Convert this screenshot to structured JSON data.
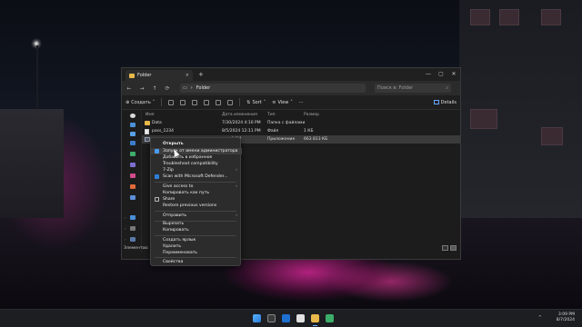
{
  "window": {
    "tab_title": "Folder",
    "tab_close": "×",
    "tab_add": "+",
    "controls": [
      "—",
      "▢",
      "✕"
    ]
  },
  "addressbar": {
    "back": "←",
    "forward": "→",
    "up": "↑",
    "refresh": "⟳",
    "path_separator": "›",
    "path": "Folder",
    "search_placeholder": "Поиск в: Folder"
  },
  "toolbar": {
    "create_label": "Создать",
    "sort_label": "Sort",
    "view_label": "View",
    "more_label": "···",
    "details_label": "Details"
  },
  "columns": {
    "name": "Имя",
    "date": "Дата изменения",
    "type": "Тип",
    "size": "Размер"
  },
  "rows": [
    {
      "name": "Data",
      "date": "7/30/2024 4:10 PM",
      "type": "Папка с файлами",
      "size": ""
    },
    {
      "name": "pass_1234",
      "date": "8/5/2024 12:11 PM",
      "type": "Файл",
      "size": "1 КБ"
    },
    {
      "name": "",
      "date": "...8 PM",
      "type": "Приложение",
      "size": "663 813 КБ"
    }
  ],
  "status": {
    "text": "Элементов: 3 | 1"
  },
  "context_menu": {
    "items": [
      {
        "label": "Открыть",
        "bold": true
      },
      {
        "label": "Запуск от имени администратора"
      },
      {
        "label": "Добавить в избранное"
      },
      {
        "label": "Troubleshoot compatibility"
      },
      {
        "label": "7-Zip",
        "submenu": true
      },
      {
        "label": "Scan with Microsoft Defender..."
      },
      {
        "label": "Give access to",
        "submenu": true
      },
      {
        "label": "Копировать как путь"
      },
      {
        "label": "Share"
      },
      {
        "label": "Restore previous versions"
      },
      {
        "label": "Отправить",
        "submenu": true
      },
      {
        "label": "Вырезать"
      },
      {
        "label": "Копировать"
      },
      {
        "label": "Создать ярлык"
      },
      {
        "label": "Удалить"
      },
      {
        "label": "Переименовать"
      },
      {
        "label": "Свойства"
      }
    ],
    "submenu_arrow": "›"
  },
  "taskbar": {
    "time": "3:09 PM",
    "date": "8/7/2024",
    "tray_chevron": "^"
  },
  "colors": {
    "accent": "#4c9aff",
    "folder": "#e8b84a",
    "wallpaper_glow": "#e628a0"
  }
}
